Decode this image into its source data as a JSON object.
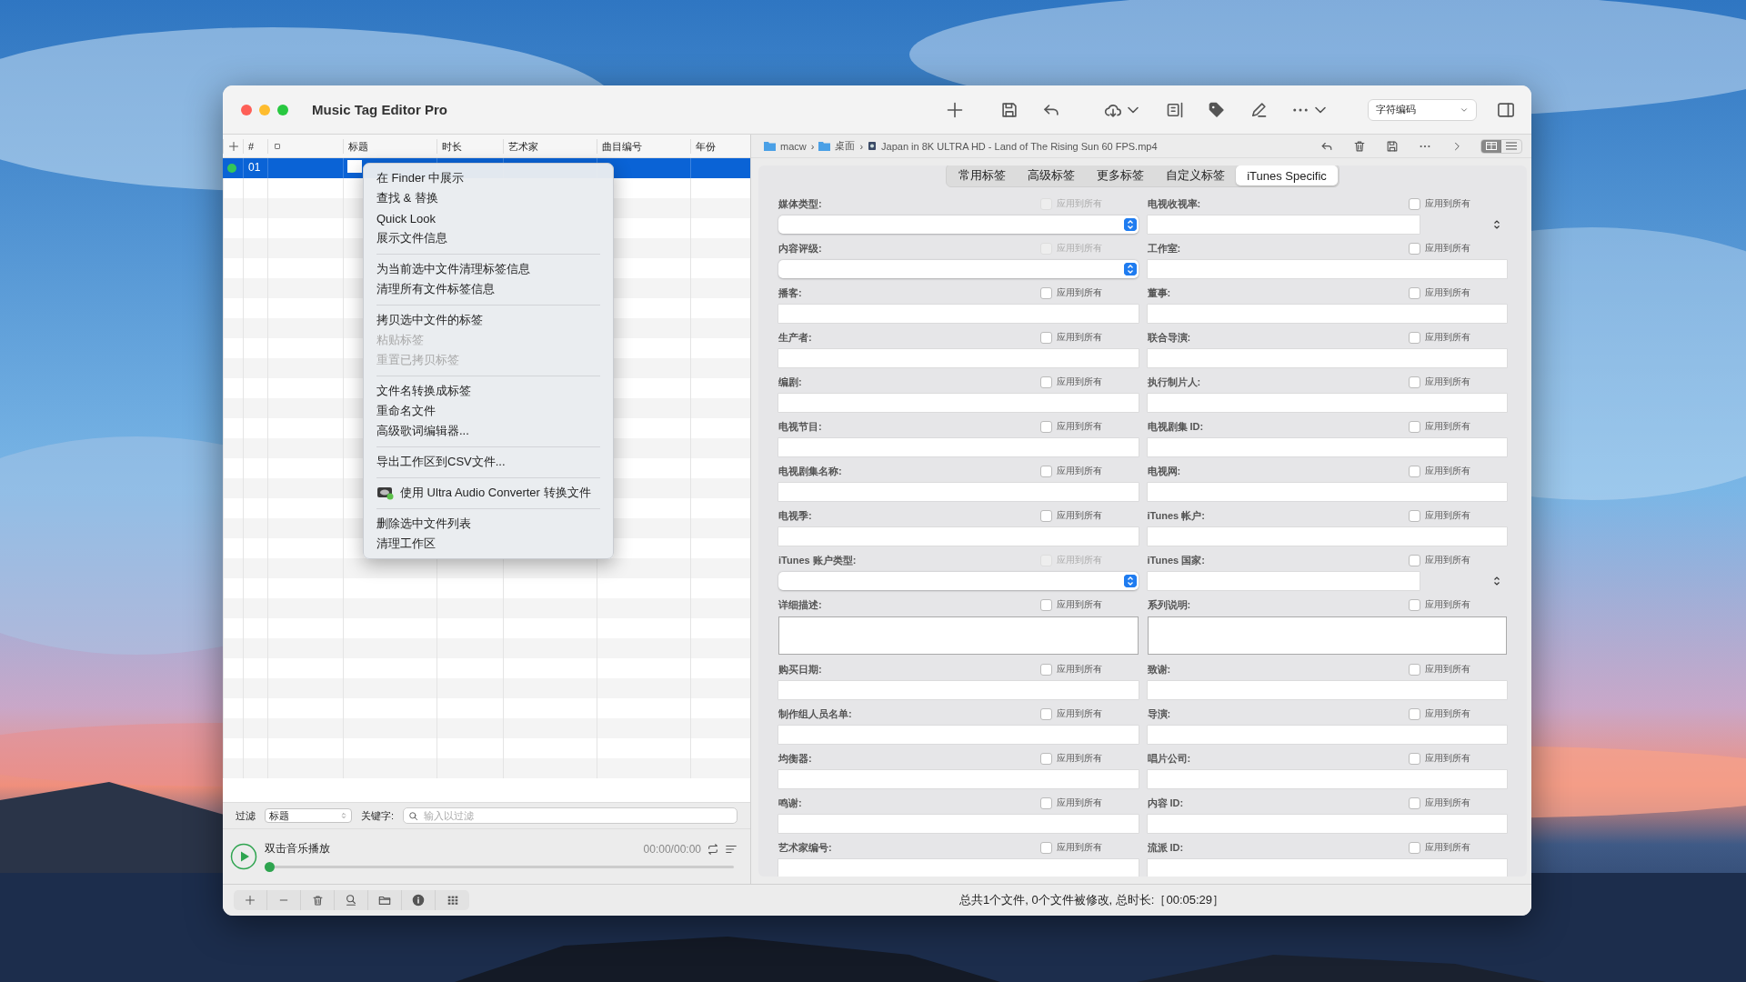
{
  "window": {
    "title": "Music Tag Editor Pro"
  },
  "toolbar": {
    "encoding": "字符编码"
  },
  "table": {
    "columns": [
      "#",
      "标题",
      "时长",
      "艺术家",
      "曲目编号",
      "年份"
    ],
    "rows": [
      {
        "number": "01",
        "color": "#34c759",
        "selected": true
      }
    ]
  },
  "context_menu": {
    "groups": [
      [
        {
          "label": "在 Finder 中展示",
          "disabled": false,
          "kind": "text"
        },
        {
          "label": "查找 & 替换",
          "disabled": false,
          "kind": "text"
        },
        {
          "label": "Quick Look",
          "disabled": false,
          "kind": "text"
        },
        {
          "label": "展示文件信息",
          "disabled": false,
          "kind": "text"
        }
      ],
      [
        {
          "label": "为当前选中文件清理标签信息",
          "disabled": false,
          "kind": "text"
        },
        {
          "label": "清理所有文件标签信息",
          "disabled": false,
          "kind": "text"
        }
      ],
      [
        {
          "label": "拷贝选中文件的标签",
          "disabled": false,
          "kind": "text"
        },
        {
          "label": "粘贴标签",
          "disabled": true,
          "kind": "text"
        },
        {
          "label": "重置已拷贝标签",
          "disabled": true,
          "kind": "text"
        }
      ],
      [
        {
          "label": "文件名转换成标签",
          "disabled": false,
          "kind": "text"
        },
        {
          "label": "重命名文件",
          "disabled": false,
          "kind": "text"
        },
        {
          "label": "高级歌词编辑器...",
          "disabled": false,
          "kind": "text"
        }
      ],
      [
        {
          "label": "导出工作区到CSV文件...",
          "disabled": false,
          "kind": "text"
        }
      ],
      [
        {
          "label": "使用 Ultra Audio Converter 转换文件",
          "disabled": false,
          "kind": "app"
        }
      ],
      [
        {
          "label": "删除选中文件列表",
          "disabled": false,
          "kind": "text"
        },
        {
          "label": "清理工作区",
          "disabled": false,
          "kind": "text"
        }
      ]
    ]
  },
  "filter": {
    "label": "过滤",
    "field": "标题",
    "keyword_label": "关键字:",
    "placeholder": "输入以过滤"
  },
  "player": {
    "hint": "双击音乐播放",
    "time": "00:00/00:00",
    "level": 0
  },
  "path": [
    "macw",
    "桌面",
    "Japan in 8K ULTRA HD - Land of The Rising Sun 60 FPS.mp4"
  ],
  "path_separator": "›",
  "tabs": [
    {
      "label": "常用标签",
      "selected": false
    },
    {
      "label": "高级标签",
      "selected": false
    },
    {
      "label": "更多标签",
      "selected": false
    },
    {
      "label": "自定义标签",
      "selected": false
    },
    {
      "label": "iTunes Specific",
      "selected": true
    }
  ],
  "fields": [
    {
      "label": "媒体类型:",
      "kind": "popup",
      "apply": "应用到所有",
      "checked": false,
      "disabled": true
    },
    {
      "label": "电视收视率:",
      "kind": "stepper",
      "apply": "应用到所有",
      "checked": false,
      "disabled": false
    },
    {
      "label": "内容评级:",
      "kind": "popup",
      "apply": "应用到所有",
      "checked": false,
      "disabled": true
    },
    {
      "label": "工作室:",
      "kind": "text",
      "apply": "应用到所有",
      "checked": false,
      "disabled": false
    },
    {
      "label": "播客:",
      "kind": "text",
      "apply": "应用到所有",
      "checked": false,
      "disabled": false
    },
    {
      "label": "董事:",
      "kind": "text",
      "apply": "应用到所有",
      "checked": false,
      "disabled": false
    },
    {
      "label": "生产者:",
      "kind": "text",
      "apply": "应用到所有",
      "checked": false,
      "disabled": false
    },
    {
      "label": "联合导演:",
      "kind": "text",
      "apply": "应用到所有",
      "checked": false,
      "disabled": false
    },
    {
      "label": "编剧:",
      "kind": "text",
      "apply": "应用到所有",
      "checked": false,
      "disabled": false
    },
    {
      "label": "执行制片人:",
      "kind": "text",
      "apply": "应用到所有",
      "checked": false,
      "disabled": false
    },
    {
      "label": "电视节目:",
      "kind": "text",
      "apply": "应用到所有",
      "checked": false,
      "disabled": false
    },
    {
      "label": "电视剧集 ID:",
      "kind": "text",
      "apply": "应用到所有",
      "checked": false,
      "disabled": false
    },
    {
      "label": "电视剧集名称:",
      "kind": "text",
      "apply": "应用到所有",
      "checked": false,
      "disabled": false
    },
    {
      "label": "电视网:",
      "kind": "text",
      "apply": "应用到所有",
      "checked": false,
      "disabled": false
    },
    {
      "label": "电视季:",
      "kind": "text",
      "apply": "应用到所有",
      "checked": false,
      "disabled": false
    },
    {
      "label": "iTunes 帐户:",
      "kind": "text",
      "apply": "应用到所有",
      "checked": false,
      "disabled": false
    },
    {
      "label": "iTunes 账户类型:",
      "kind": "popup",
      "apply": "应用到所有",
      "checked": false,
      "disabled": true
    },
    {
      "label": "iTunes 国家:",
      "kind": "stepper",
      "apply": "应用到所有",
      "checked": false,
      "disabled": false
    },
    {
      "label": "详细描述:",
      "kind": "textarea",
      "apply": "应用到所有",
      "checked": false,
      "disabled": false
    },
    {
      "label": "系列说明:",
      "kind": "textarea",
      "apply": "应用到所有",
      "checked": false,
      "disabled": false
    },
    {
      "label": "购买日期:",
      "kind": "text",
      "apply": "应用到所有",
      "checked": false,
      "disabled": false
    },
    {
      "label": "致谢:",
      "kind": "text",
      "apply": "应用到所有",
      "checked": false,
      "disabled": false
    },
    {
      "label": "制作组人员名单:",
      "kind": "text",
      "apply": "应用到所有",
      "checked": false,
      "disabled": false
    },
    {
      "label": "导演:",
      "kind": "text",
      "apply": "应用到所有",
      "checked": false,
      "disabled": false
    },
    {
      "label": "均衡器:",
      "kind": "text",
      "apply": "应用到所有",
      "checked": false,
      "disabled": false
    },
    {
      "label": "唱片公司:",
      "kind": "text",
      "apply": "应用到所有",
      "checked": false,
      "disabled": false
    },
    {
      "label": "鸣谢:",
      "kind": "text",
      "apply": "应用到所有",
      "checked": false,
      "disabled": false
    },
    {
      "label": "内容 ID:",
      "kind": "text",
      "apply": "应用到所有",
      "checked": false,
      "disabled": false
    },
    {
      "label": "艺术家编号:",
      "kind": "text",
      "apply": "应用到所有",
      "checked": false,
      "disabled": false
    },
    {
      "label": "流派 ID:",
      "kind": "text",
      "apply": "应用到所有",
      "checked": false,
      "disabled": false
    }
  ],
  "status_bar": {
    "text": "总共1个文件, 0个文件被修改, 总时长:［00:05:29］"
  }
}
